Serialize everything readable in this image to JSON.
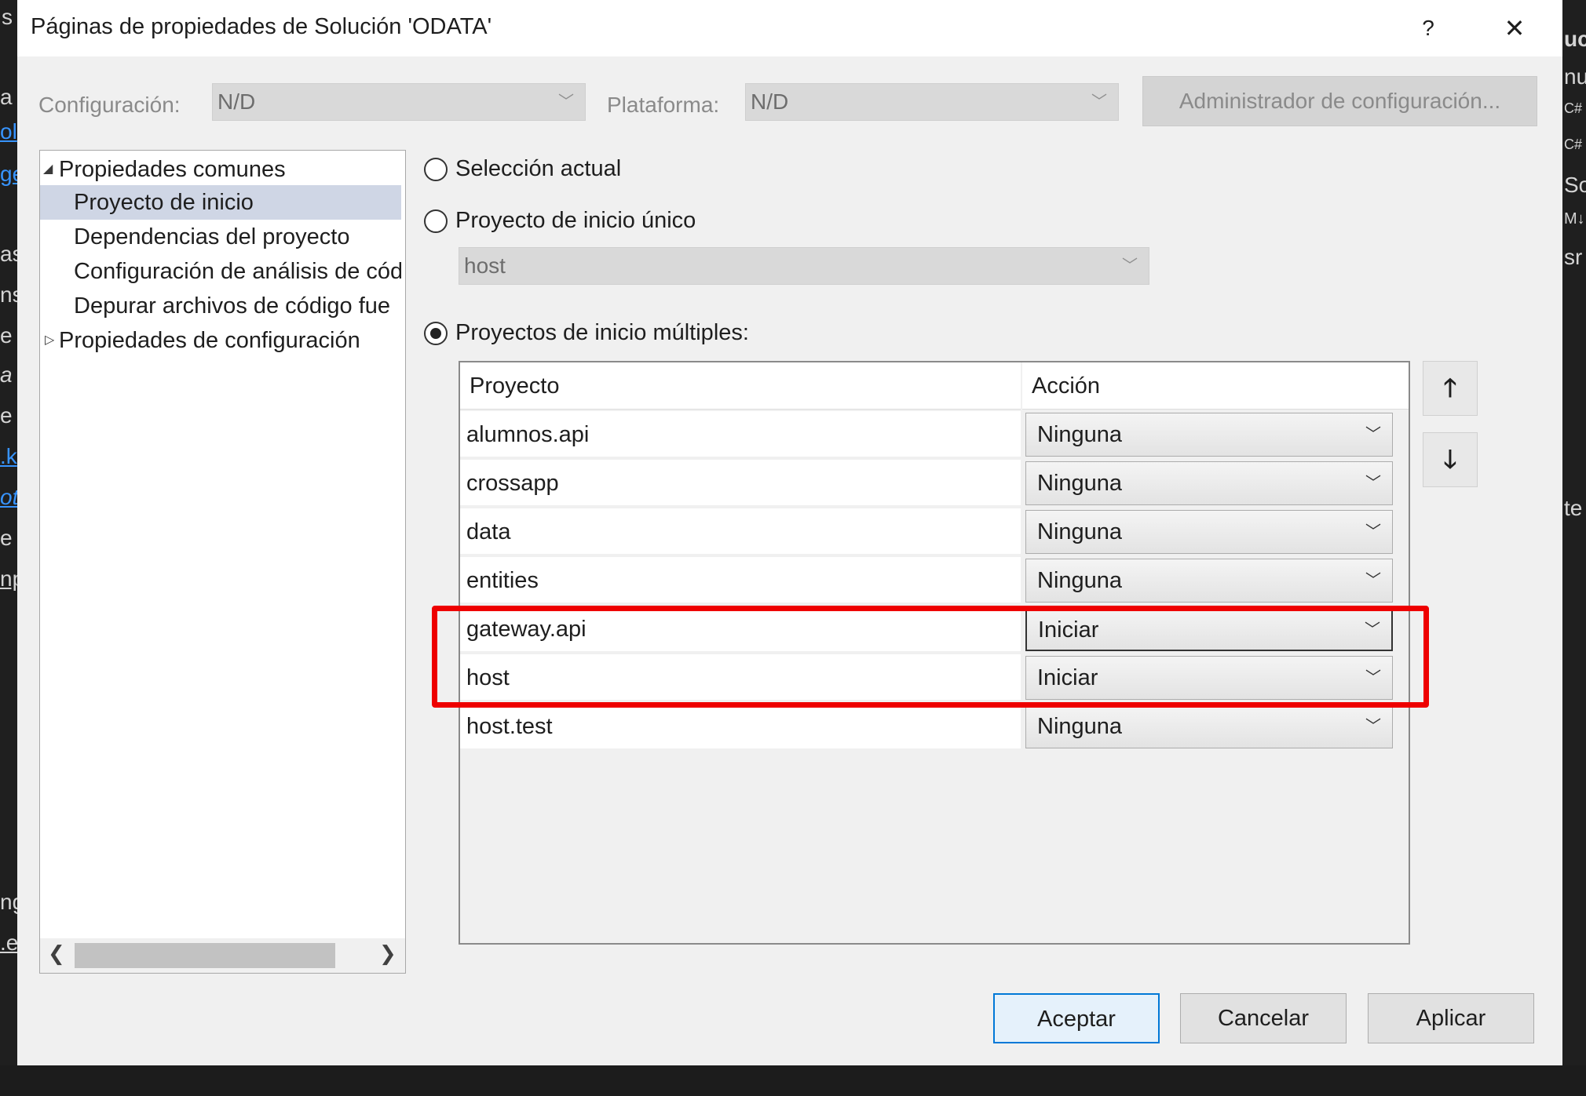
{
  "background_ide": {
    "left_fragments": [
      "s",
      "a",
      "ol",
      "ge",
      "as",
      "ns",
      "e",
      "a",
      "e",
      ".k",
      "ot",
      "e",
      "np",
      "ng",
      ".e"
    ],
    "right_fragments": [
      "uc",
      "nu",
      "C#",
      "C#",
      "So",
      "M↓",
      "sr",
      "te"
    ]
  },
  "dialog": {
    "title": "Páginas de propiedades de Solución 'ODATA'",
    "help_label": "?",
    "close_label": "✕"
  },
  "toolbar": {
    "config_label": "Configuración:",
    "config_value": "N/D",
    "platform_label": "Plataforma:",
    "platform_value": "N/D",
    "config_manager_button": "Administrador de configuración..."
  },
  "tree": {
    "items": [
      {
        "label": "Propiedades comunes",
        "expanded": true,
        "level": 0
      },
      {
        "label": "Proyecto de inicio",
        "selected": true,
        "level": 1
      },
      {
        "label": "Dependencias del proyecto",
        "level": 1
      },
      {
        "label": "Configuración de análisis de cód",
        "level": 1
      },
      {
        "label": "Depurar archivos de código fue",
        "level": 1
      },
      {
        "label": "Propiedades de configuración",
        "expanded": false,
        "level": 0
      }
    ]
  },
  "startup": {
    "option_current": "Selección actual",
    "option_single": "Proyecto de inicio único",
    "single_project_value": "host",
    "option_multiple": "Proyectos de inicio múltiples:",
    "selected_option": "multiple"
  },
  "grid": {
    "col_project": "Proyecto",
    "col_action": "Acción",
    "rows": [
      {
        "project": "alumnos.api",
        "action": "Ninguna"
      },
      {
        "project": "crossapp",
        "action": "Ninguna"
      },
      {
        "project": "data",
        "action": "Ninguna"
      },
      {
        "project": "entities",
        "action": "Ninguna"
      },
      {
        "project": "gateway.api",
        "action": "Iniciar"
      },
      {
        "project": "host",
        "action": "Iniciar"
      },
      {
        "project": "host.test",
        "action": "Ninguna"
      }
    ]
  },
  "move_buttons": {
    "up": "🡑",
    "down": "🡓"
  },
  "footer": {
    "ok": "Aceptar",
    "cancel": "Cancelar",
    "apply": "Aplicar"
  },
  "colors": {
    "highlight_box": "#ee0000",
    "selected_tree_item": "#cfd6e5",
    "default_button_border": "#0078d7"
  }
}
